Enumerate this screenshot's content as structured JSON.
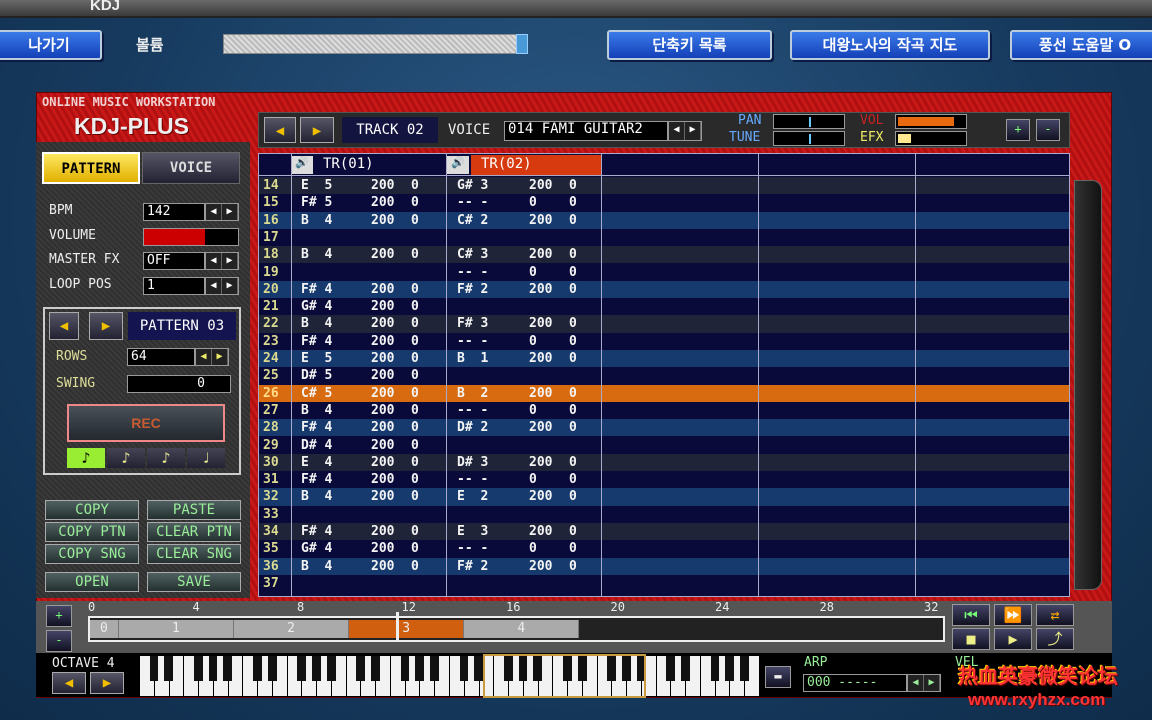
{
  "window": {
    "title": "KDJ"
  },
  "topbar": {
    "back_label": "나가기",
    "volume_label": "볼륨",
    "volume_level": 0.98,
    "buttons": [
      "단축키 목록",
      "대왕노사의 작곡 지도",
      "풍선 도움말 O"
    ]
  },
  "brand": {
    "subtitle": "ONLINE MUSIC WORKSTATION",
    "logo": "KDJ-PLUS"
  },
  "tabs": {
    "pattern": "PATTERN",
    "voice": "VOICE",
    "active": "PATTERN"
  },
  "settings": {
    "bpm_label": "BPM",
    "bpm": "142",
    "volume_label": "VOLUME",
    "volume_level": 0.65,
    "master_fx_label": "MASTER FX",
    "master_fx": "OFF",
    "loop_pos_label": "LOOP POS",
    "loop_pos": "1"
  },
  "pattern": {
    "name": "PATTERN 03",
    "rows_label": "ROWS",
    "rows": "64",
    "swing_label": "SWING",
    "swing": "0",
    "rec_label": "REC",
    "note_lengths": [
      "♪",
      "♪",
      "♪",
      "♩"
    ],
    "active_note_length": 0
  },
  "actions": [
    [
      "COPY",
      "PASTE"
    ],
    [
      "COPY PTN",
      "CLEAR PTN"
    ],
    [
      "COPY SNG",
      "CLEAR SNG"
    ],
    [
      "OPEN",
      "SAVE"
    ]
  ],
  "track": {
    "label": "TRACK 02",
    "voice_label": "VOICE",
    "voice": "014 FAMI GUITAR2",
    "pan_label": "PAN",
    "tune_label": "TUNE",
    "vol_label": "VOL",
    "efx_label": "EFX",
    "pan": 0.5,
    "tune": 0.5,
    "vol": 0.85,
    "efx": 0.2,
    "plus": "+",
    "minus": "-"
  },
  "columns": [
    "TR(01)",
    "TR(02)"
  ],
  "current_row": 26,
  "rows": [
    [
      14,
      "E  5",
      "200",
      "0",
      "G# 3",
      "200",
      "0"
    ],
    [
      15,
      "F# 5",
      "200",
      "0",
      "-- -",
      "0",
      "0"
    ],
    [
      16,
      "B  4",
      "200",
      "0",
      "C# 2",
      "200",
      "0"
    ],
    [
      17,
      "",
      "",
      "",
      "",
      "",
      ""
    ],
    [
      18,
      "B  4",
      "200",
      "0",
      "C# 3",
      "200",
      "0"
    ],
    [
      19,
      "",
      "",
      "",
      "-- -",
      "0",
      "0"
    ],
    [
      20,
      "F# 4",
      "200",
      "0",
      "F# 2",
      "200",
      "0"
    ],
    [
      21,
      "G# 4",
      "200",
      "0",
      "",
      "",
      ""
    ],
    [
      22,
      "B  4",
      "200",
      "0",
      "F# 3",
      "200",
      "0"
    ],
    [
      23,
      "F# 4",
      "200",
      "0",
      "-- -",
      "0",
      "0"
    ],
    [
      24,
      "E  5",
      "200",
      "0",
      "B  1",
      "200",
      "0"
    ],
    [
      25,
      "D# 5",
      "200",
      "0",
      "",
      "",
      ""
    ],
    [
      26,
      "C# 5",
      "200",
      "0",
      "B  2",
      "200",
      "0"
    ],
    [
      27,
      "B  4",
      "200",
      "0",
      "-- -",
      "0",
      "0"
    ],
    [
      28,
      "F# 4",
      "200",
      "0",
      "D# 2",
      "200",
      "0"
    ],
    [
      29,
      "D# 4",
      "200",
      "0",
      "",
      "",
      ""
    ],
    [
      30,
      "E  4",
      "200",
      "0",
      "D# 3",
      "200",
      "0"
    ],
    [
      31,
      "F# 4",
      "200",
      "0",
      "-- -",
      "0",
      "0"
    ],
    [
      32,
      "B  4",
      "200",
      "0",
      "E  2",
      "200",
      "0"
    ],
    [
      33,
      "",
      "",
      "",
      "",
      "",
      ""
    ],
    [
      34,
      "F# 4",
      "200",
      "0",
      "E  3",
      "200",
      "0"
    ],
    [
      35,
      "G# 4",
      "200",
      "0",
      "-- -",
      "0",
      "0"
    ],
    [
      36,
      "B  4",
      "200",
      "0",
      "F# 2",
      "200",
      "0"
    ],
    [
      37,
      "",
      "",
      "",
      "",
      "",
      ""
    ]
  ],
  "timeline": {
    "ticks": [
      "0",
      "4",
      "8",
      "12",
      "16",
      "20",
      "24",
      "28",
      "32"
    ],
    "patterns": [
      "0",
      "1",
      "2",
      "3",
      "4"
    ],
    "active_pattern": "3",
    "plus": "+",
    "minus": "-"
  },
  "keyboard": {
    "octave_label": "OCTAVE 4",
    "arp_label": "ARP",
    "arp": "000 -----",
    "vel_label": "VEL"
  },
  "watermark": {
    "line1": "热血英豪微笑论坛",
    "line2": "www.rxyhzx.com"
  },
  "colors": {
    "accent_orange": "#d86a10",
    "panel_red": "#c01414",
    "grid_bg": "#0a0a3a"
  }
}
